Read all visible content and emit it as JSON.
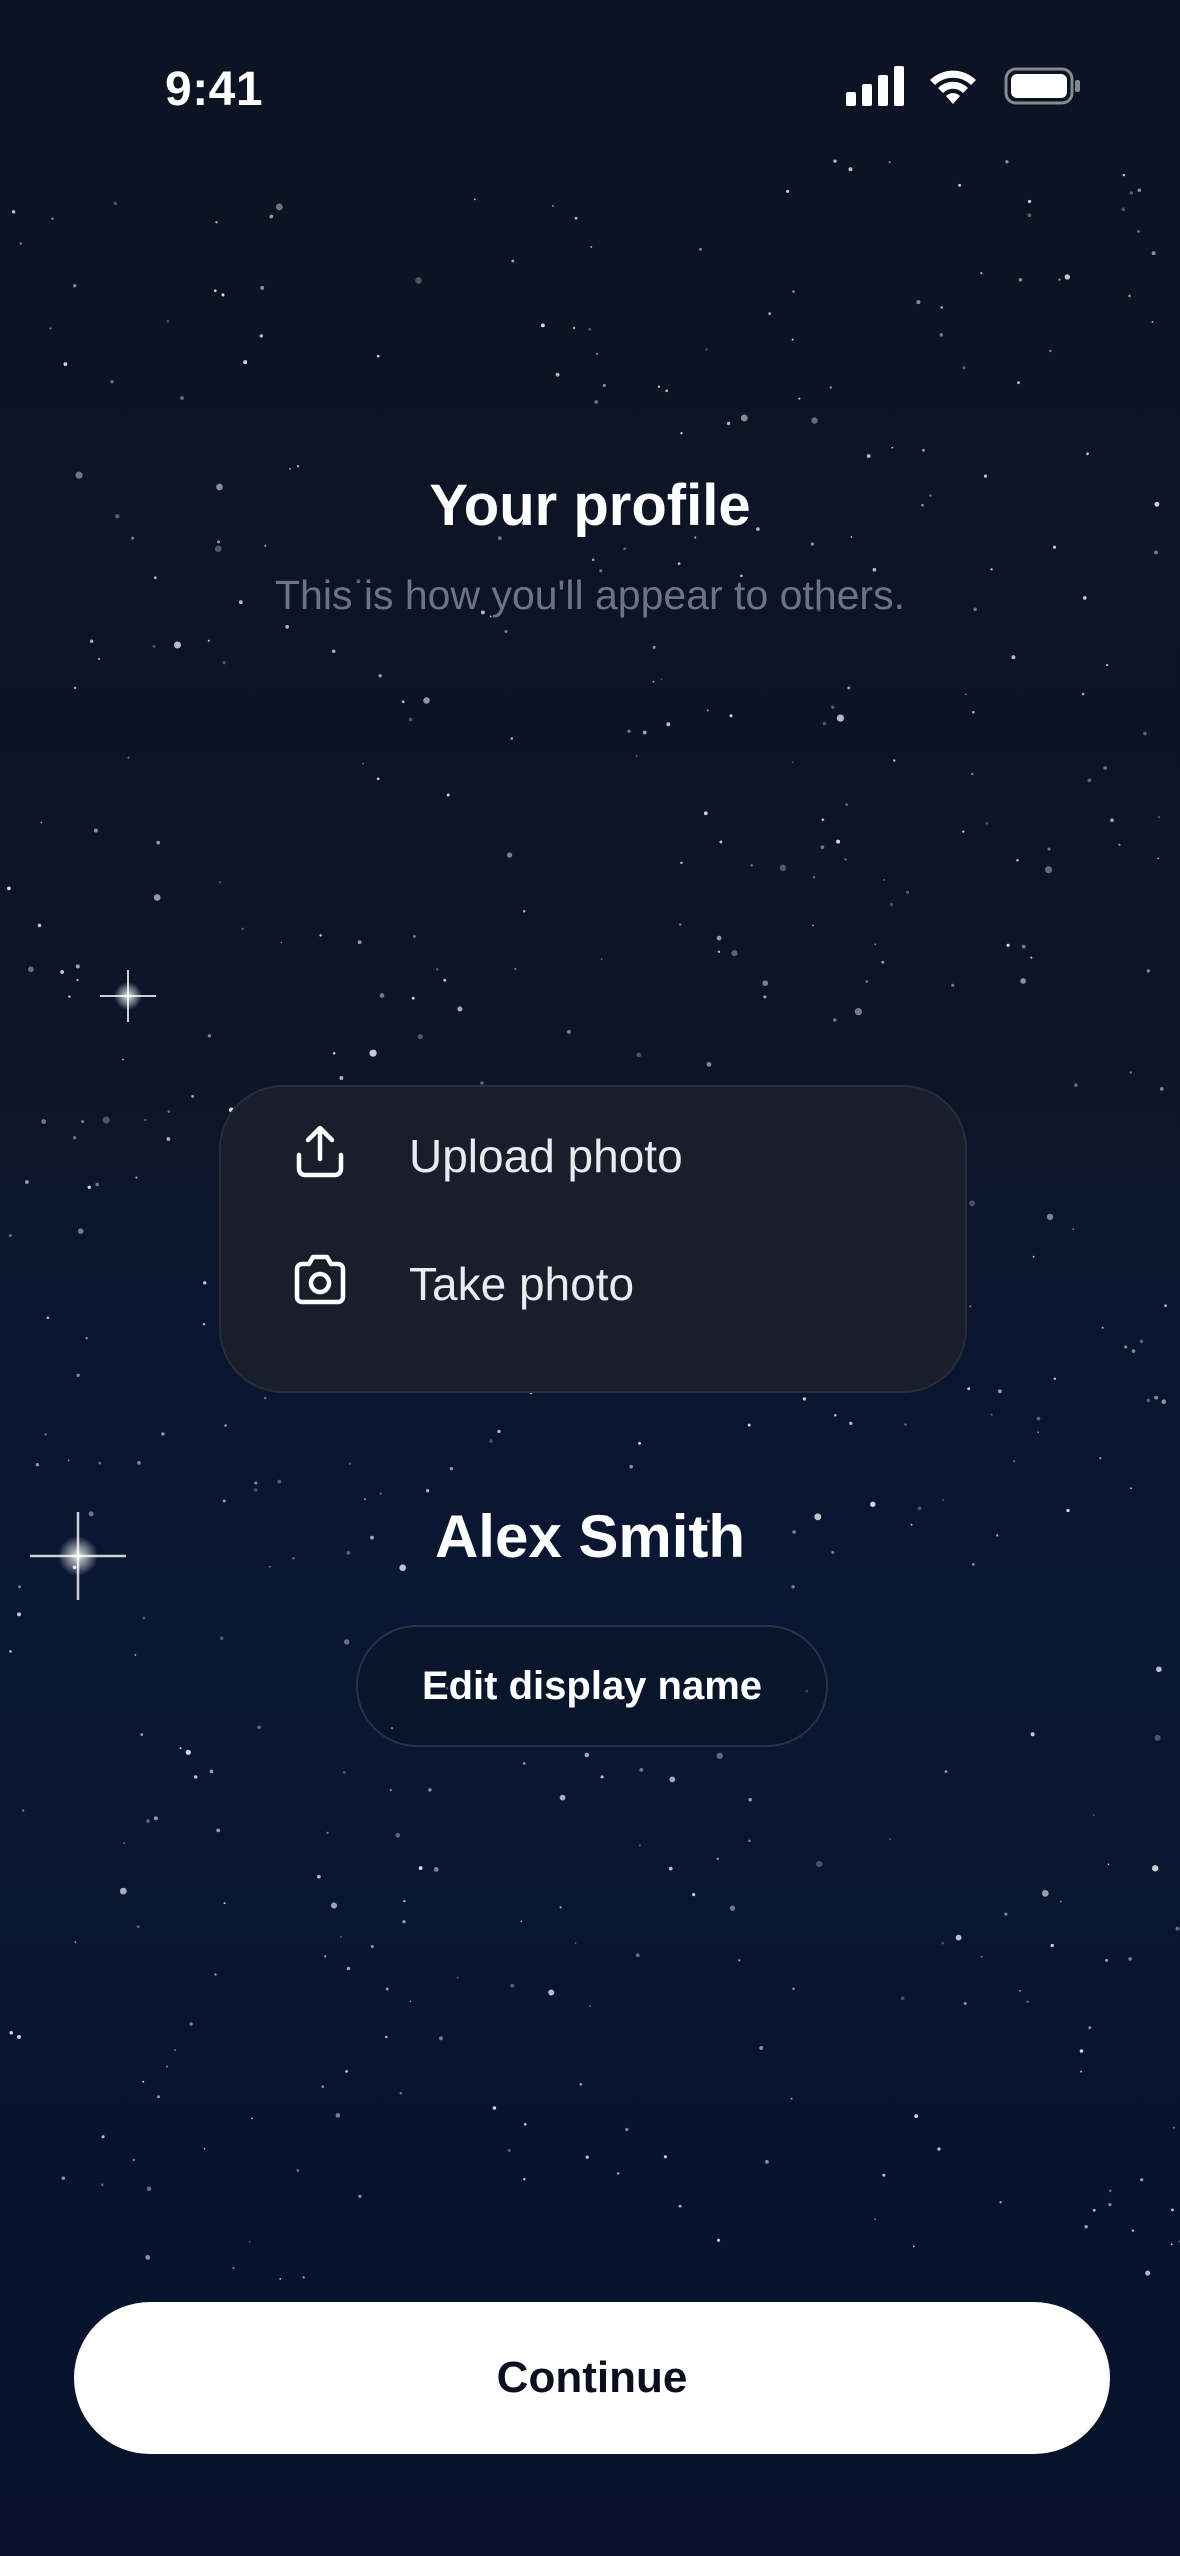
{
  "status_bar": {
    "time": "9:41",
    "icons": [
      "cellular-signal-icon",
      "wifi-icon",
      "battery-icon"
    ]
  },
  "header": {
    "title": "Your profile",
    "subtitle": "This is how you'll appear to others."
  },
  "photo_menu": {
    "items": [
      {
        "icon": "upload-icon",
        "label": "Upload photo"
      },
      {
        "icon": "camera-icon",
        "label": "Take photo"
      }
    ]
  },
  "profile": {
    "display_name": "Alex Smith",
    "edit_button_label": "Edit display name"
  },
  "footer": {
    "continue_label": "Continue"
  },
  "colors": {
    "background_top": "#0c1322",
    "background_bottom": "#07122a",
    "menu_background": "#191e2c",
    "subtitle_text": "#6c7482",
    "primary_button": "#ffffff",
    "primary_button_text": "#0b1020"
  }
}
